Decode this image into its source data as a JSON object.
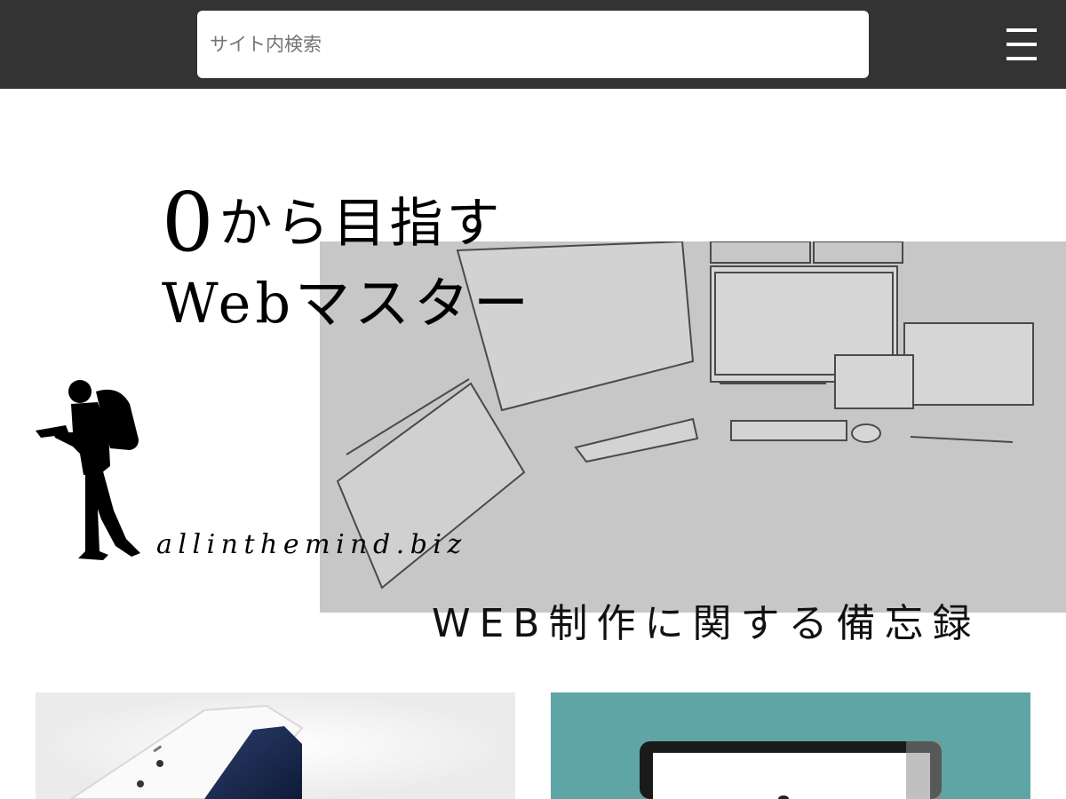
{
  "search": {
    "placeholder": "サイト内検索",
    "value": ""
  },
  "menu": {
    "icon": "hamburger-icon"
  },
  "hero": {
    "title_zero": "0",
    "title_line1_rest": "から目指す",
    "title_line2": "Webマスター",
    "domain": "allinthemind.biz",
    "tagline": "WEB制作に関する備忘録"
  },
  "cards": [
    {
      "thumbnail": "smartphone-photo"
    },
    {
      "thumbnail": "laptop-on-teal-photo"
    }
  ],
  "colors": {
    "topbar": "#333333",
    "hero_photo": "#c7c7c7",
    "card1_bg": "#ebebeb",
    "card2_bg": "#5fa5a6"
  }
}
